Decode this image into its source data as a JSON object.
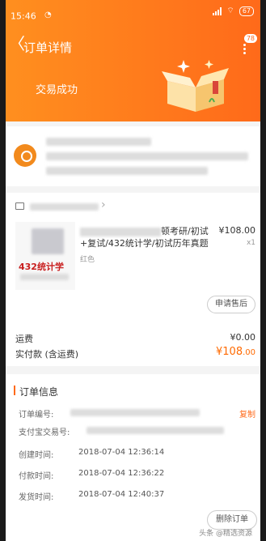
{
  "status_bar": {
    "time": "15:46",
    "battery": "67"
  },
  "header": {
    "back_glyph": "〈",
    "title": "订单详情",
    "more_badge": "78",
    "trade_status": "交易成功"
  },
  "product": {
    "name_fragment": "顿考研/初试+复试/432统计学/初试历年真题",
    "price": "¥108.00",
    "qty": "x1",
    "sku": "红色",
    "thumb_label": "432统计学",
    "after_sale_button": "申请售后"
  },
  "fees": {
    "shipping_label": "运费",
    "shipping_value": "¥0.00",
    "paid_label": "实付款 (含运费)",
    "paid_main": "¥108",
    "paid_decimal": ".00"
  },
  "order_info": {
    "section_title": "订单信息",
    "order_no_label": "订单编号:",
    "copy_label": "复制",
    "alipay_no_label": "支付宝交易号:",
    "created_label": "创建时间:",
    "created_value": "2018-07-04 12:36:14",
    "paid_time_label": "付款时间:",
    "paid_time_value": "2018-07-04 12:36:22",
    "shipped_label": "发货时间:",
    "shipped_value": "2018-07-04 12:40:37",
    "delete_button": "删除订单"
  },
  "watermark": "头条 @精选资源",
  "colors": {
    "accent": "#ff6a1a",
    "header_start": "#ff8f1f",
    "price": "#ff6a00"
  },
  "icons": [
    "back-icon",
    "more-icon",
    "location-pin-icon",
    "shop-icon",
    "chevron-right-icon"
  ]
}
